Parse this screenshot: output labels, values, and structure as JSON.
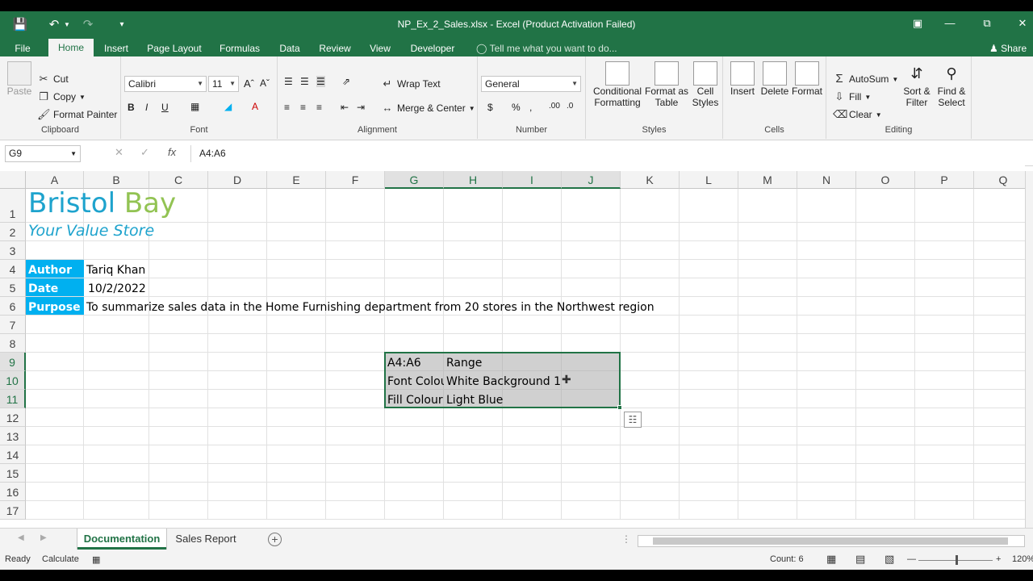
{
  "window": {
    "title": "NP_Ex_2_Sales.xlsx - Excel (Product Activation Failed)",
    "share_label": "Share"
  },
  "tabs": [
    "File",
    "Home",
    "Insert",
    "Page Layout",
    "Formulas",
    "Data",
    "Review",
    "View",
    "Developer"
  ],
  "tell_me": "Tell me what you want to do...",
  "ribbon": {
    "clipboard": {
      "paste": "Paste",
      "cut": "Cut",
      "copy": "Copy",
      "format_painter": "Format Painter",
      "label": "Clipboard"
    },
    "font": {
      "name": "Calibri",
      "size": "11",
      "bold": "B",
      "italic": "I",
      "underline": "U",
      "label": "Font"
    },
    "alignment": {
      "wrap_text": "Wrap Text",
      "merge_center": "Merge & Center",
      "label": "Alignment"
    },
    "number": {
      "format": "General",
      "label": "Number"
    },
    "styles": {
      "conditional": "Conditional",
      "conditional2": "Formatting",
      "format_as": "Format as",
      "format_as2": "Table",
      "cell": "Cell",
      "cell2": "Styles",
      "label": "Styles"
    },
    "cells": {
      "insert": "Insert",
      "delete": "Delete",
      "format": "Format",
      "label": "Cells"
    },
    "editing": {
      "autosum": "AutoSum",
      "fill": "Fill",
      "clear": "Clear",
      "sort": "Sort &",
      "sort2": "Filter",
      "find": "Find &",
      "find2": "Select",
      "label": "Editing"
    }
  },
  "formula_bar": {
    "name_box": "G9",
    "formula": "A4:A6",
    "fx": "fx"
  },
  "columns": [
    "A",
    "B",
    "C",
    "D",
    "E",
    "F",
    "G",
    "H",
    "I",
    "J",
    "K",
    "L",
    "M",
    "N",
    "O",
    "P",
    "Q"
  ],
  "rows": [
    "1",
    "2",
    "3",
    "4",
    "5",
    "6",
    "7",
    "8",
    "9",
    "10",
    "11",
    "12",
    "13",
    "14",
    "15",
    "16",
    "17"
  ],
  "cells": {
    "title_bristol": "Bristol",
    "title_bay": "Bay",
    "subtitle": "Your Value Store",
    "author_label": "Author",
    "author_value": "Tariq Khan",
    "date_label": "Date",
    "date_value": "10/2/2022",
    "purpose_label": "Purpose",
    "purpose_value": "To summarize sales data in the Home Furnishing department from 20 stores in the Northwest region",
    "g9": "A4:A6",
    "h9": "Range",
    "g10": "Font Colour",
    "h10": "White Background 1",
    "g11": "Fill Colour",
    "h11": "Light Blue"
  },
  "sheets": [
    "Documentation",
    "Sales Report"
  ],
  "status": {
    "ready": "Ready",
    "calculate": "Calculate",
    "count": "Count: 6",
    "zoom": "120%"
  },
  "colors": {
    "brand": "#217346",
    "label_fill": "#00b0f0",
    "title_blue": "#1ea3cd",
    "title_green": "#92c353"
  }
}
